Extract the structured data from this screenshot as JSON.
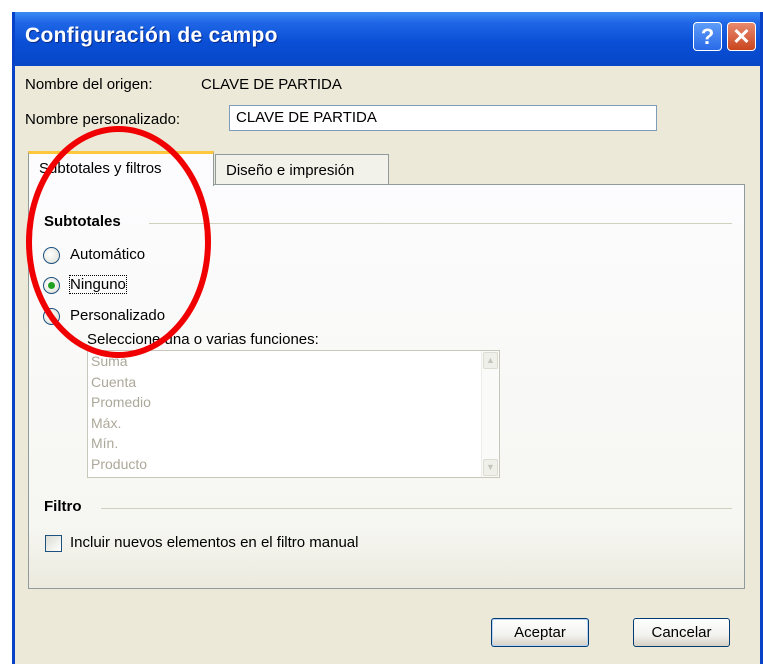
{
  "window": {
    "title": "Configuración de campo",
    "help_glyph": "?",
    "close_glyph": "✕"
  },
  "source_name": {
    "label": "Nombre del origen:",
    "value": "CLAVE DE PARTIDA"
  },
  "custom_name": {
    "label": "Nombre personalizado:",
    "value": "CLAVE DE PARTIDA"
  },
  "tabs": [
    {
      "label": "Subtotales y filtros",
      "active": true
    },
    {
      "label": "Diseño e impresión",
      "active": false
    }
  ],
  "subtotals": {
    "title": "Subtotales",
    "options": [
      {
        "label": "Automático",
        "selected": false
      },
      {
        "label": "Ninguno",
        "selected": true
      },
      {
        "label": "Personalizado",
        "selected": false
      }
    ],
    "functions_label": "Seleccione una o varias funciones:",
    "functions": [
      "Suma",
      "Cuenta",
      "Promedio",
      "Máx.",
      "Mín.",
      "Producto"
    ]
  },
  "filter": {
    "title": "Filtro",
    "include_new_label": "Incluir nuevos elementos en el filtro manual",
    "include_new_checked": false
  },
  "buttons": {
    "ok": "Aceptar",
    "cancel": "Cancelar"
  },
  "annotation": {
    "color": "#f00000"
  }
}
